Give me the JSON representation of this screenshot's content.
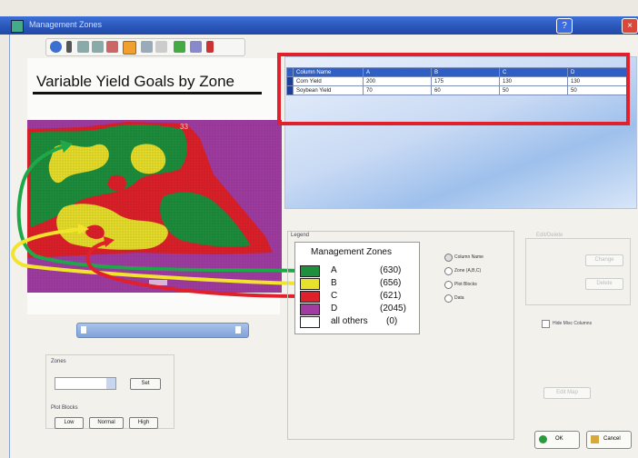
{
  "window": {
    "title": "Management Zones"
  },
  "map": {
    "title": "Variable Yield Goals by Zone",
    "badge": "33"
  },
  "grid": {
    "headers": [
      "Column Name",
      "A",
      "B",
      "C",
      "D"
    ],
    "rows": [
      [
        "Corn Yield",
        "200",
        "175",
        "130",
        "130"
      ],
      [
        "Soybean Yield",
        "70",
        "60",
        "50",
        "50"
      ]
    ]
  },
  "legend": {
    "frame_label": "Legend",
    "title": "Management Zones",
    "items": [
      {
        "zone": "A",
        "count": "(630)",
        "color": "#1e8f3c"
      },
      {
        "zone": "B",
        "count": "(656)",
        "color": "#e8e02a"
      },
      {
        "zone": "C",
        "count": "(621)",
        "color": "#e0202a"
      },
      {
        "zone": "D",
        "count": "(2045)",
        "color": "#a23ca3"
      },
      {
        "zone": "all others",
        "count": "(0)",
        "color": "#ffffff"
      }
    ]
  },
  "label_by": {
    "options": [
      "Column Name",
      "Zone (A,B,C)",
      "Plot Blocks",
      "Data"
    ]
  },
  "zones": {
    "label": "Zones",
    "set_button": "Set"
  },
  "plot_blocks": {
    "label": "Plot Blocks",
    "buttons": [
      "Low",
      "Normal",
      "High"
    ]
  },
  "hide_misc": {
    "label": "Hide Misc Columns"
  },
  "right_panel": {
    "group_label": "Edit/Delete",
    "button1": "Change",
    "button2": "Delete",
    "edit_button": "Edit Map"
  },
  "actions": {
    "ok": "OK",
    "cancel": "Cancel"
  }
}
